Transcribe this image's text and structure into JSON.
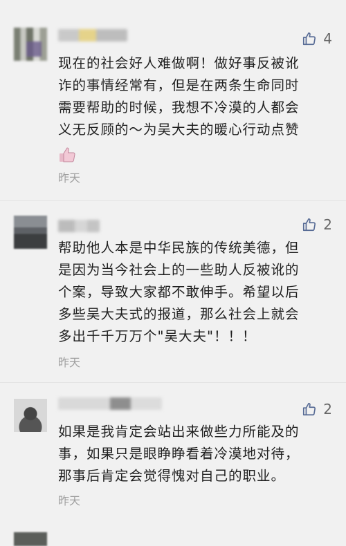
{
  "comments": [
    {
      "likes": "4",
      "text": "现在的社会好人难做啊！做好事反被讹\n诈的事情经常有，但是在两条生命同时\n需要帮助的时候，我想不冷漠的人都会\n义无反顾的～为吴大夫的暖心行动点赞",
      "emoji": "thumbs-up-emoji",
      "time": "昨天"
    },
    {
      "likes": "2",
      "text": "帮助他人本是中华民族的传统美德，但\n是因为当今社会上的一些助人反被讹的\n个案，导致大家都不敢伸手。希望以后\n多些吴大夫式的报道，那么社会上就会\n多出千千万万个\"吴大夫\"！！！",
      "time": "昨天"
    },
    {
      "likes": "2",
      "text": "如果是我肯定会站出来做些力所能及的\n事，如果只是眼睁睁看着冷漠地对待，\n那事后肯定会觉得愧对自己的职业。",
      "time": "昨天"
    }
  ],
  "colors": {
    "background": "#f1f1f1",
    "like_icon": "#576b95",
    "time_text": "#9e9e9e"
  },
  "icons": {
    "like": "thumbs-up-outline-icon"
  }
}
